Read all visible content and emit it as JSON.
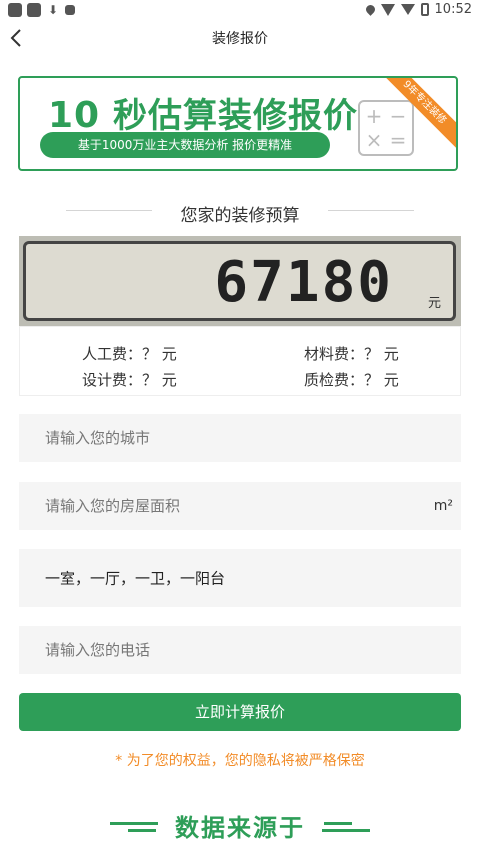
{
  "status_bar": {
    "time": "10:52"
  },
  "header": {
    "title": "装修报价"
  },
  "banner": {
    "title_num": "10",
    "title_text": " 秒估算装修报价",
    "subtitle": "基于1000万业主大数据分析  报价更精准",
    "ribbon": "9年专注装修"
  },
  "budget": {
    "title": "您家的装修预算",
    "value": "67180",
    "unit": "元"
  },
  "fees": {
    "labor": "人工费：？ 元",
    "material": "材料费：？ 元",
    "design": "设计费：？ 元",
    "inspection": "质检费：？ 元"
  },
  "form": {
    "city_placeholder": "请输入您的城市",
    "area_placeholder": "请输入您的房屋面积",
    "area_unit": "m²",
    "layout_value": "一室，一厅，一卫，一阳台",
    "phone_placeholder": "请输入您的电话",
    "submit_label": "立即计算报价"
  },
  "privacy_note": "* 为了您的权益，您的隐私将被严格保密",
  "data_source_title": "数据来源于",
  "colors": {
    "accent": "#2e9e58",
    "orange": "#f28c28"
  }
}
